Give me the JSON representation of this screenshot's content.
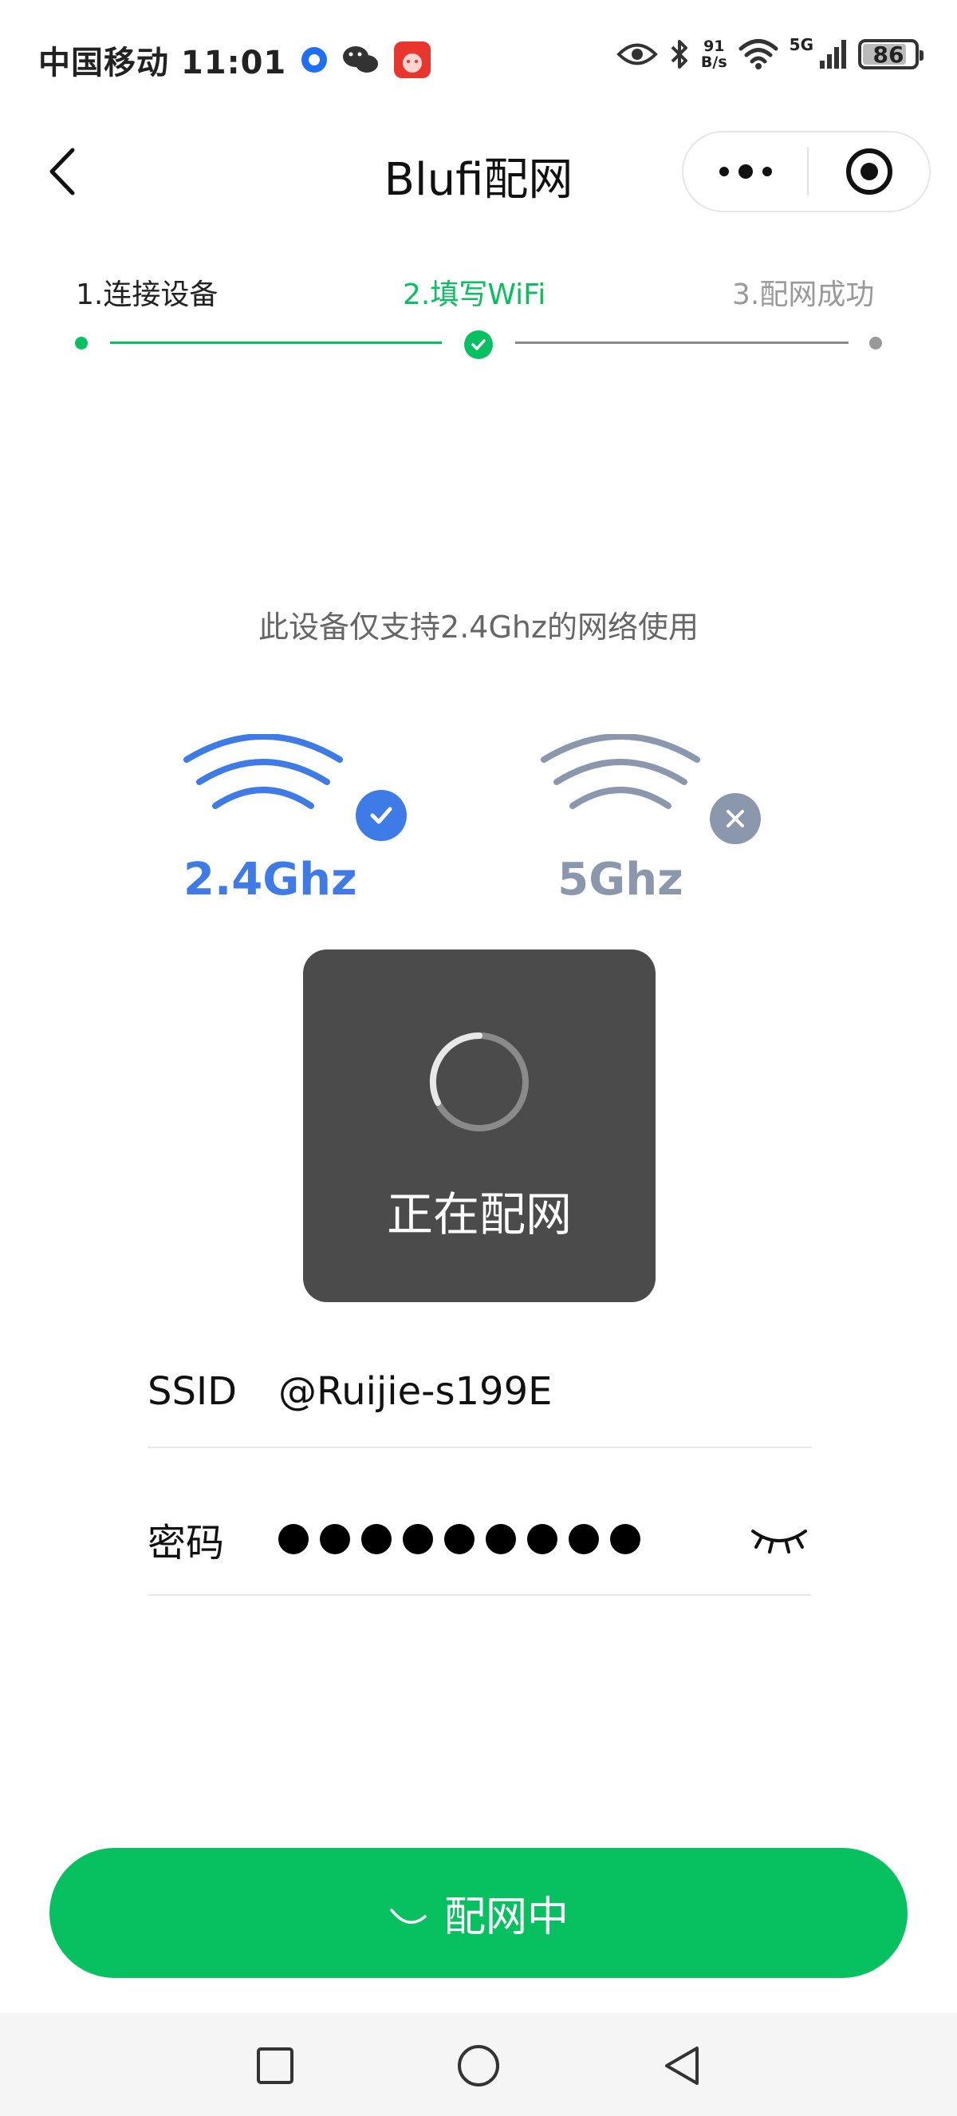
{
  "status_bar": {
    "carrier_time": "中国移动 11:01",
    "net_speed_value": "91",
    "net_speed_unit": "B/s",
    "network_type": "5G",
    "battery_level": "86",
    "battery_fraction": 0.86
  },
  "nav": {
    "title": "Blufi配网"
  },
  "steps": [
    {
      "label": "1.连接设备",
      "state": "done"
    },
    {
      "label": "2.填写WiFi",
      "state": "active"
    },
    {
      "label": "3.配网成功",
      "state": "pending"
    }
  ],
  "notice": "此设备仅支持2.4Ghz的网络使用",
  "bands": {
    "band_24": {
      "label": "2.4Ghz",
      "supported": true
    },
    "band_5": {
      "label": "5Ghz",
      "supported": false
    }
  },
  "form": {
    "ssid_label": "SSID",
    "ssid_value": "@Ruijie-s199E",
    "password_label": "密码",
    "password_mask_count": 9
  },
  "toast": {
    "text": "正在配网"
  },
  "submit": {
    "label": "配网中"
  },
  "colors": {
    "accent_green": "#07c160",
    "band_24_blue": "#3f7be6",
    "band_5_gray": "#8a97ad",
    "inactive_gray": "#999999"
  },
  "icons": [
    "back-arrow-icon",
    "more-dots-icon",
    "close-target-icon",
    "step-check-icon",
    "wifi-icon",
    "check-icon",
    "cross-icon",
    "loading-spinner-icon",
    "eye-closed-icon",
    "square-icon",
    "circle-icon",
    "triangle-back-icon"
  ]
}
